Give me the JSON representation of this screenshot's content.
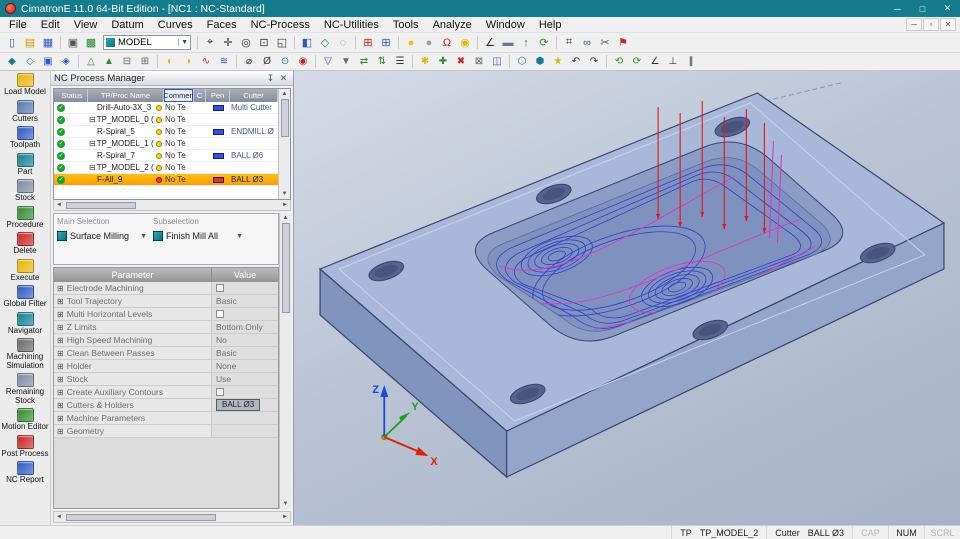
{
  "window": {
    "title": "CimatronE 11.0 64-Bit Edition - [NC1 : NC-Standard]",
    "controls": {
      "minimize": "─",
      "maximize": "□",
      "close": "✕"
    }
  },
  "menubar": {
    "items": [
      "File",
      "Edit",
      "View",
      "Datum",
      "Curves",
      "Faces",
      "NC-Process",
      "NC-Utilities",
      "Tools",
      "Analyze",
      "Window",
      "Help"
    ],
    "child_controls": [
      "─",
      "▫",
      "✕"
    ]
  },
  "toolbar1": {
    "model_combo": {
      "value": "MODEL"
    },
    "icons_left": [
      {
        "name": "new-file-icon",
        "glyph": "▯",
        "color": "#3a5fa8"
      },
      {
        "name": "open-file-icon",
        "glyph": "▤",
        "color": "#d39a00"
      },
      {
        "name": "save-icon",
        "glyph": "▦",
        "color": "#2a58c8"
      },
      {
        "sep": true
      },
      {
        "name": "print-icon",
        "glyph": "▣",
        "color": "#555555"
      },
      {
        "name": "pdm-icon",
        "glyph": "▩",
        "color": "#2d8a2d"
      }
    ],
    "icons_right": [
      {
        "sep": true
      },
      {
        "name": "select-icon",
        "glyph": "⌖",
        "color": "#333333"
      },
      {
        "name": "pan-icon",
        "glyph": "✛",
        "color": "#333333"
      },
      {
        "name": "zoom-icon",
        "glyph": "◎",
        "color": "#333333"
      },
      {
        "name": "zoom-window-icon",
        "glyph": "⊡",
        "color": "#333333"
      },
      {
        "name": "fit-view-icon",
        "glyph": "◱",
        "color": "#333333"
      },
      {
        "sep": true
      },
      {
        "name": "shaded-view-icon",
        "glyph": "◧",
        "color": "#2a58c8"
      },
      {
        "name": "wireframe-view-icon",
        "glyph": "◇",
        "color": "#0e7f8f"
      },
      {
        "name": "hidden-line-icon",
        "glyph": "◌",
        "color": "#667788"
      },
      {
        "sep": true
      },
      {
        "name": "grid-red-icon",
        "glyph": "⊞",
        "color": "#cc2222"
      },
      {
        "name": "grid-blue-icon",
        "glyph": "⊞",
        "color": "#2a58c8"
      },
      {
        "sep": true
      },
      {
        "name": "light-on-icon",
        "glyph": "●",
        "color": "#f0c000"
      },
      {
        "name": "light-off-icon",
        "glyph": "●",
        "color": "#9aa0a8"
      },
      {
        "name": "magnet-icon",
        "glyph": "Ω",
        "color": "#cc2222"
      },
      {
        "name": "ball-icon",
        "glyph": "◉",
        "color": "#e8b400"
      },
      {
        "sep": true
      },
      {
        "name": "measure-angle-icon",
        "glyph": "∠",
        "color": "#333333"
      },
      {
        "name": "ruler-icon",
        "glyph": "▬",
        "color": "#667788"
      },
      {
        "name": "arrow-up-icon",
        "glyph": "↑",
        "color": "#2d8a2d"
      },
      {
        "name": "refresh-icon",
        "glyph": "⟳",
        "color": "#2d8a2d"
      },
      {
        "sep": true
      },
      {
        "name": "snap-grid-icon",
        "glyph": "⌗",
        "color": "#333333"
      },
      {
        "name": "link-icon",
        "glyph": "∞",
        "color": "#2a58c8"
      },
      {
        "name": "scissors-icon",
        "glyph": "✂",
        "color": "#555555"
      },
      {
        "name": "flag-icon",
        "glyph": "⚑",
        "color": "#cc2222"
      }
    ]
  },
  "toolbar2": {
    "icons": [
      {
        "name": "simulate-icon",
        "glyph": "◆",
        "color": "#0e7f8f"
      },
      {
        "name": "verify-icon",
        "glyph": "◇",
        "color": "#0e7f8f"
      },
      {
        "name": "machine-icon",
        "glyph": "▣",
        "color": "#2a58c8"
      },
      {
        "name": "stock-icon",
        "glyph": "◈",
        "color": "#2a58c8"
      },
      {
        "sep": true
      },
      {
        "name": "tool-icon",
        "glyph": "△",
        "color": "#2d8a2d"
      },
      {
        "name": "holder-icon",
        "glyph": "▲",
        "color": "#2d8a2d"
      },
      {
        "name": "collapse-icon",
        "glyph": "⊟",
        "color": "#666666"
      },
      {
        "name": "expand-icon",
        "glyph": "⊞",
        "color": "#666666"
      },
      {
        "sep": true
      },
      {
        "name": "halfmoon-icon",
        "glyph": "◐",
        "color": "#e8b400"
      },
      {
        "name": "halfmoon2-icon",
        "glyph": "◑",
        "color": "#e8b400"
      },
      {
        "name": "wave-icon",
        "glyph": "∿",
        "color": "#cc2222"
      },
      {
        "name": "waves-icon",
        "glyph": "≋",
        "color": "#2a58c8"
      },
      {
        "sep": true
      },
      {
        "name": "diameter-icon",
        "glyph": "⌀",
        "color": "#333333"
      },
      {
        "name": "axis-icon",
        "glyph": "Ø",
        "color": "#333333"
      },
      {
        "name": "target-icon",
        "glyph": "⊙",
        "color": "#0e7f8f"
      },
      {
        "name": "record-icon",
        "glyph": "◉",
        "color": "#cc2222"
      },
      {
        "sep": true
      },
      {
        "name": "down-tri-icon",
        "glyph": "▽",
        "color": "#2a58c8"
      },
      {
        "name": "drop-icon",
        "glyph": "▼",
        "color": "#666666"
      },
      {
        "name": "swap-h-icon",
        "glyph": "⇄",
        "color": "#2d8a2d"
      },
      {
        "name": "swap-v-icon",
        "glyph": "⇅",
        "color": "#2d8a2d"
      },
      {
        "name": "layers-icon",
        "glyph": "☰",
        "color": "#333333"
      },
      {
        "sep": true
      },
      {
        "name": "settings-icon",
        "glyph": "✱",
        "color": "#e8b400"
      },
      {
        "name": "add-icon",
        "glyph": "✚",
        "color": "#2d8a2d"
      },
      {
        "name": "delete-icon",
        "glyph": "✖",
        "color": "#cc2222"
      },
      {
        "name": "box-x-icon",
        "glyph": "⊠",
        "color": "#666666"
      },
      {
        "name": "window-icon",
        "glyph": "◫",
        "color": "#2a58c8"
      },
      {
        "sep": true
      },
      {
        "name": "hex-icon",
        "glyph": "⬡",
        "color": "#0e7f8f"
      },
      {
        "name": "hex-solid-icon",
        "glyph": "⬢",
        "color": "#0e7f8f"
      },
      {
        "name": "star-icon",
        "glyph": "★",
        "color": "#e8b400"
      },
      {
        "name": "undo-icon",
        "glyph": "↶",
        "color": "#333333"
      },
      {
        "name": "redo-icon",
        "glyph": "↷",
        "color": "#333333"
      },
      {
        "sep": true
      },
      {
        "name": "cycle-left-icon",
        "glyph": "⟲",
        "color": "#2d8a2d"
      },
      {
        "name": "cycle-right-icon",
        "glyph": "⟳",
        "color": "#2d8a2d"
      },
      {
        "name": "angle-icon",
        "glyph": "∠",
        "color": "#333333"
      },
      {
        "name": "perpendicular-icon",
        "glyph": "⊥",
        "color": "#333333"
      },
      {
        "name": "parallel-icon",
        "glyph": "∥",
        "color": "#333333"
      }
    ]
  },
  "sidebar": {
    "items": [
      {
        "label": "Load Model",
        "color": "#e8b400"
      },
      {
        "label": "Cutters",
        "color": "#5577aa"
      },
      {
        "label": "Toolpath",
        "color": "#2a58c8"
      },
      {
        "label": "Part",
        "color": "#0e7f8f"
      },
      {
        "label": "Stock",
        "color": "#7a8aa0"
      },
      {
        "label": "Procedure",
        "color": "#2d8a2d"
      },
      {
        "label": "Delete",
        "color": "#cc2222"
      },
      {
        "label": "Execute",
        "color": "#e8b400"
      },
      {
        "label": "Global Filter",
        "color": "#2a58c8"
      },
      {
        "label": "Navigator",
        "color": "#0e7f8f"
      },
      {
        "label": "Machining Simulation",
        "color": "#666666"
      },
      {
        "label": "Remaining Stock",
        "color": "#7a8aa0"
      },
      {
        "label": "Motion Editor",
        "color": "#2d8a2d"
      },
      {
        "label": "Post Process",
        "color": "#cc2222"
      },
      {
        "label": "NC Report",
        "color": "#2a58c8"
      }
    ]
  },
  "process_manager": {
    "title": "NC Process Manager",
    "pin_icon": "↧",
    "close_icon": "✕",
    "columns": [
      "Status",
      "TP/Proc Name",
      "Commen",
      "C",
      "Pen",
      "Cutter"
    ],
    "rows": [
      {
        "name": "Drill-Auto-3X_3",
        "expander": false,
        "indent": true,
        "comment": "No Te",
        "pen": "#2b50ff",
        "cutter": "Multi Cutter",
        "selected": false
      },
      {
        "name": "TP_MODEL_0 (",
        "expander": true,
        "indent": false,
        "comment": "No Te",
        "pen": "",
        "cutter": "",
        "selected": false
      },
      {
        "name": "R-Spiral_5",
        "expander": false,
        "indent": true,
        "comment": "No Te",
        "pen": "#2b50ff",
        "cutter": "ENDMILL Ø",
        "selected": false
      },
      {
        "name": "TP_MODEL_1 (",
        "expander": true,
        "indent": false,
        "comment": "No Te",
        "pen": "",
        "cutter": "",
        "selected": false
      },
      {
        "name": "R-Spiral_7",
        "expander": false,
        "indent": true,
        "comment": "No Te",
        "pen": "#2b50ff",
        "cutter": "BALL Ø6",
        "selected": false
      },
      {
        "name": "TP_MODEL_2 (",
        "expander": true,
        "indent": false,
        "comment": "No Te",
        "pen": "",
        "cutter": "",
        "selected": false
      },
      {
        "name": "F-All_9",
        "expander": false,
        "indent": true,
        "comment": "No Te",
        "pen": "#e03030",
        "cutter": "BALL Ø3",
        "selected": true
      }
    ]
  },
  "selection": {
    "main_label": "Main Selection",
    "sub_label": "Subselection",
    "main_value": "Surface Milling",
    "sub_value": "Finish Mill All",
    "caret": "▼"
  },
  "parameters": {
    "columns": [
      "Parameter",
      "Value"
    ],
    "rows": [
      {
        "name": "Electrode Machining",
        "value": "",
        "checkbox": true,
        "button": false
      },
      {
        "name": "Tool Trajectory",
        "value": "Basic",
        "checkbox": false,
        "button": false
      },
      {
        "name": "Multi Horizontal Levels",
        "value": "",
        "checkbox": true,
        "button": false
      },
      {
        "name": "Z Limits",
        "value": "Bottom Only",
        "checkbox": false,
        "button": false
      },
      {
        "name": "High Speed Machining",
        "value": "No",
        "checkbox": false,
        "button": false
      },
      {
        "name": "Clean Between Passes",
        "value": "Basic",
        "checkbox": false,
        "button": false
      },
      {
        "name": "Holder",
        "value": "None",
        "checkbox": false,
        "button": false
      },
      {
        "name": "Stock",
        "value": "Use",
        "checkbox": false,
        "button": false
      },
      {
        "name": "Create Auxiliary Contours",
        "value": "",
        "checkbox": true,
        "button": false
      },
      {
        "name": "Cutters & Holders",
        "value": "BALL Ø3",
        "checkbox": false,
        "button": true
      },
      {
        "name": "Machine Parameters",
        "value": "",
        "checkbox": false,
        "button": false
      },
      {
        "name": "Geometry",
        "value": "",
        "checkbox": false,
        "button": false
      }
    ]
  },
  "viewport": {
    "axes": {
      "x": "X",
      "y": "Y",
      "z": "Z"
    }
  },
  "statusbar": {
    "tp_label": "TP",
    "tp_value": "TP_MODEL_2",
    "cutter_label": "Cutter",
    "cutter_value": "BALL Ø3",
    "cap": "CAP",
    "num": "NUM",
    "scrl": "SCRL"
  }
}
